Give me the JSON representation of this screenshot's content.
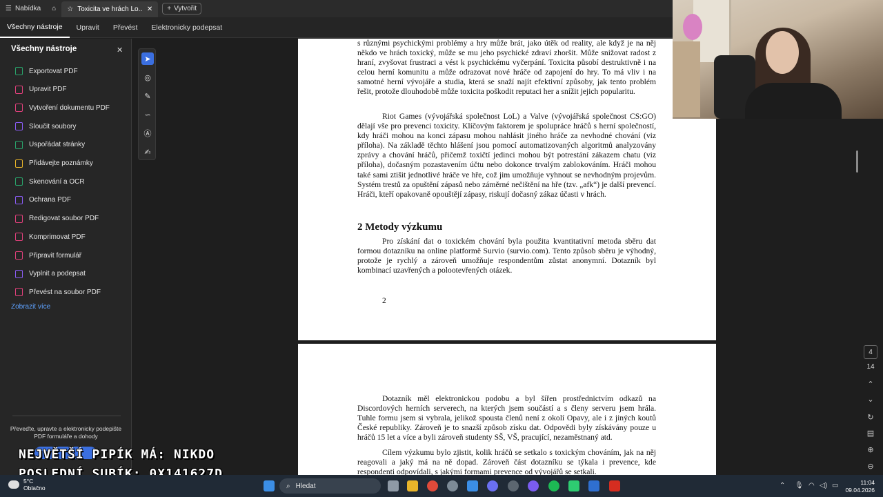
{
  "topbar": {
    "menu_label": "Nabídka",
    "tab_title": "Toxicita ve hrách Lo...",
    "create_label": "Vytvořit"
  },
  "nav": {
    "items": [
      "Všechny nástroje",
      "Upravit",
      "Převést",
      "Elektronicky podepsat"
    ]
  },
  "left_panel": {
    "title": "Všechny nástroje",
    "tools": [
      {
        "label": "Exportovat PDF",
        "icon": "export-pdf-icon",
        "color": "#29a36a"
      },
      {
        "label": "Upravit PDF",
        "icon": "edit-pdf-icon",
        "color": "#e0407b"
      },
      {
        "label": "Vytvoření dokumentu PDF",
        "icon": "create-pdf-icon",
        "color": "#e0407b"
      },
      {
        "label": "Sloučit soubory",
        "icon": "merge-files-icon",
        "color": "#8a5cf5"
      },
      {
        "label": "Uspořádat stránky",
        "icon": "organize-pages-icon",
        "color": "#29a36a"
      },
      {
        "label": "Přidávejte poznámky",
        "icon": "comment-icon",
        "color": "#e8b42a"
      },
      {
        "label": "Skenování a OCR",
        "icon": "scan-ocr-icon",
        "color": "#29a36a"
      },
      {
        "label": "Ochrana PDF",
        "icon": "protect-pdf-icon",
        "color": "#8a5cf5"
      },
      {
        "label": "Redigovat soubor PDF",
        "icon": "redact-pdf-icon",
        "color": "#e0407b"
      },
      {
        "label": "Komprimovat PDF",
        "icon": "compress-pdf-icon",
        "color": "#e0407b"
      },
      {
        "label": "Připravit formulář",
        "icon": "prepare-form-icon",
        "color": "#e0407b"
      },
      {
        "label": "Vyplnit a podepsat",
        "icon": "fill-sign-icon",
        "color": "#8a5cf5"
      },
      {
        "label": "Převést na soubor PDF",
        "icon": "convert-pdf-icon",
        "color": "#e0407b"
      }
    ],
    "more_label": "Zobrazit více",
    "promo_text": "Převeďte, upravte a elektronicky podepište PDF formuláře a dohody"
  },
  "document": {
    "page1": {
      "para1": "s různými psychickými problémy a hry může brát, jako útěk od reality, ale když je na něj někdo ve hrách toxický, může se mu jeho psychické zdraví zhoršit. Může snižovat radost z hraní, zvyšovat frustraci a vést k psychickému vyčerpání. Toxicita působí destruktivně i na celou herní komunitu a může odrazovat nové hráče od zapojení do hry. To má vliv i na samotné herní vývojáře a studia, která se snaží najít efektivní způsoby, jak tento problém řešit, protože dlouhodobě může toxicita poškodit reputaci her a snížit jejich popularitu.",
      "para2": "Riot Games (vývojářská společnost LoL) a Valve (vývojářská společnost CS:GO) dělají vše pro prevenci toxicity. Klíčovým faktorem je spolupráce hráčů s herní společností, kdy hráči mohou na konci zápasu mohou nahlásit jiného hráče za nevhodné chování (viz příloha). Na základě těchto hlášení jsou pomocí automatizovaných algoritmů analyzovány zprávy a chování hráčů, přičemž toxičtí jedinci mohou být potrestání zákazem chatu (viz příloha), dočasným pozastavením účtu nebo dokonce trvalým zablokováním. Hráči mohou také sami ztišit jednotlivé hráče ve hře, což jim umožňuje vyhnout se nevhodným projevům. Systém trestů za opuštění zápasů nebo záměrné nečištění na hře (tzv. „afk“) je další prevencí. Hráči, kteří opakovaně opouštějí zápasy, riskují dočasný zákaz účasti v hrách.",
      "heading": "2   Metody výzkumu",
      "para3": "Pro získání dat o toxickém chování byla použita kvantitativní metoda sběru dat formou dotazníku na online platformě Survio (survio.com). Tento způsob sběru je výhodný, protože je rychlý a zároveň umožňuje respondentům zůstat anonymní. Dotazník byl kombinací uzavřených a polootevřených otázek.",
      "page_number": "2"
    },
    "page2": {
      "para1": "Dotazník měl elektronickou podobu a byl šířen prostřednictvím odkazů na Discordových herních serverech, na kterých jsem součástí a s členy serveru jsem hrála. Tuhle formu jsem si vybrala, jelikož spousta členů není z okolí Opavy, ale i z jiných koutů České republiky. Zároveň je to snazší způsob získu dat.  Odpovědi byly získávány pouze u hráčů 15 let a více a byli zároveň studenty SŠ, VŠ, pracující, nezaměstnaný atd.",
      "para2": "Cílem výzkumu bylo zjistit, kolik hráčů se setkalo s toxickým chováním, jak na něj reagovali a jaký má na ně dopad. Zároveň část dotazníku se týkala i prevence, kde respondenti odpovídali, s jakými formami prevence od vývojářů se setkali."
    }
  },
  "right_controls": {
    "current_page": "4",
    "total_pages": "14"
  },
  "overlay": {
    "line1": "NEJVĚTŠÍ PIPÍK MÁ: NIKDO",
    "line2": "POSLEDNÍ SUBÍK: 0X141627D"
  },
  "taskbar": {
    "weather_temp": "5°C",
    "weather_desc": "Oblačno",
    "weather_badge": "1",
    "search_placeholder": "Hledat",
    "time": "11:04",
    "date": "09.04.2026"
  },
  "colors": {
    "accent": "#3b6fe0",
    "link": "#5ea2ff"
  }
}
